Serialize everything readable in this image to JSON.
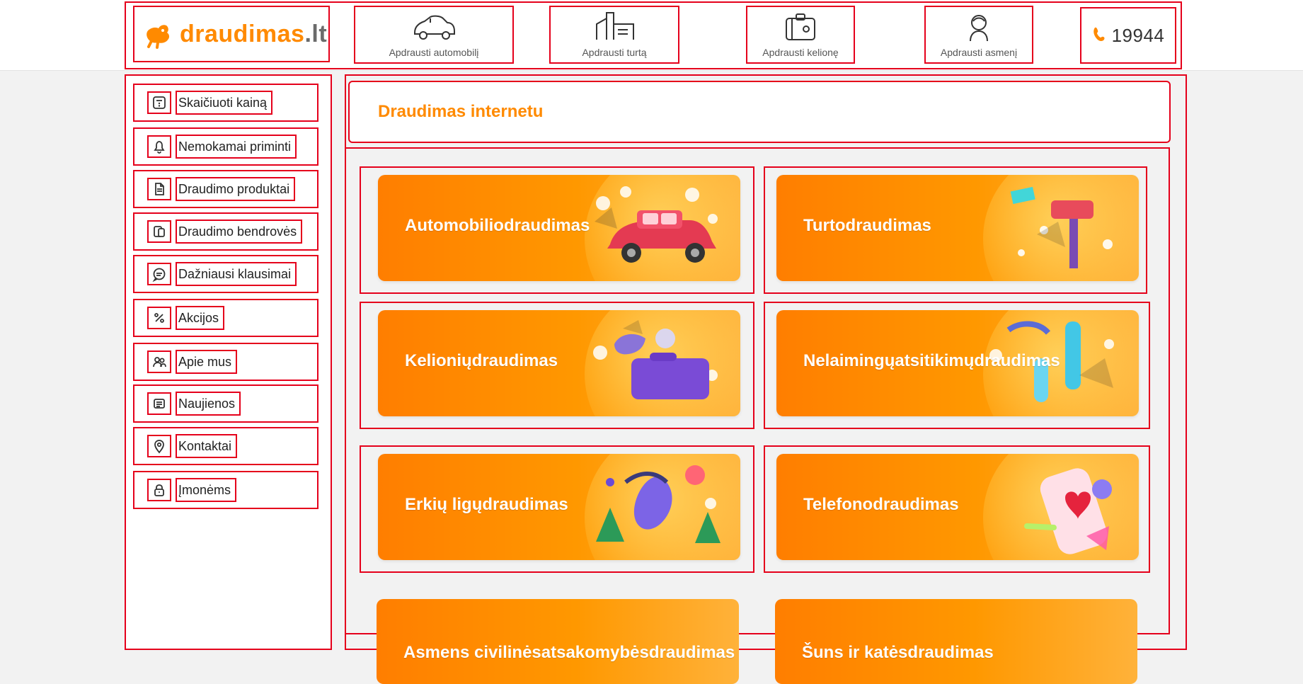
{
  "header": {
    "logo": {
      "brand": "draudimas",
      "tld": ".lt"
    },
    "nav": [
      {
        "label": "Apdrausti automobilį",
        "icon": "car-icon"
      },
      {
        "label": "Apdrausti turtą",
        "icon": "building-icon"
      },
      {
        "label": "Apdrausti kelionę",
        "icon": "suitcase-icon"
      },
      {
        "label": "Apdrausti asmenį",
        "icon": "person-icon"
      }
    ],
    "phone": {
      "number": "19944",
      "icon": "phone-icon"
    }
  },
  "sidebar": {
    "items": [
      {
        "label": "Skaičiuoti kainą",
        "icon": "calculator-icon"
      },
      {
        "label": "Nemokamai priminti",
        "icon": "bell-icon"
      },
      {
        "label": "Draudimo produktai",
        "icon": "document-icon"
      },
      {
        "label": "Draudimo bendrovės",
        "icon": "devices-icon"
      },
      {
        "label": "Dažniausi klausimai",
        "icon": "chat-icon"
      },
      {
        "label": "Akcijos",
        "icon": "percent-icon"
      },
      {
        "label": "Apie mus",
        "icon": "users-icon"
      },
      {
        "label": "Naujienos",
        "icon": "newspaper-icon"
      },
      {
        "label": "Kontaktai",
        "icon": "location-pin-icon"
      },
      {
        "label": "Įmonėms",
        "icon": "lock-icon"
      }
    ]
  },
  "main": {
    "title": "Draudimas internetu",
    "cards": [
      {
        "title": "Automobiliodraudimas",
        "art": "car-art"
      },
      {
        "title": "Turtodraudimas",
        "art": "mailbox-art"
      },
      {
        "title": "Kelioniųdraudimas",
        "art": "luggage-art"
      },
      {
        "title": "Nelaimingųatsitikimųdraudimas",
        "art": "accident-art"
      },
      {
        "title": "Erkių ligųdraudimas",
        "art": "tick-forest-art"
      },
      {
        "title": "Telefonodraudimas",
        "art": "phone-heart-art"
      }
    ],
    "cut_cards": [
      {
        "title": "Asmens civilinėsatsakomybėsdraudimas"
      },
      {
        "title": "Šuns ir katėsdraudimas"
      }
    ]
  },
  "colors": {
    "accent": "#ff8a00",
    "outline": "#e5001b"
  }
}
